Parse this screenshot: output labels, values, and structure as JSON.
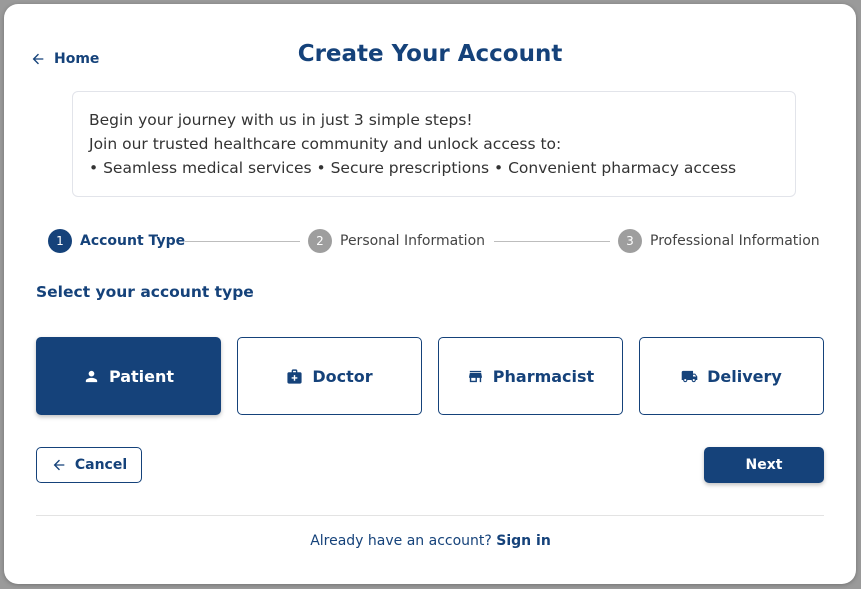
{
  "nav": {
    "home_label": "Home"
  },
  "header": {
    "title": "Create Your Account"
  },
  "intro": {
    "line1": "Begin your journey with us in just 3 simple steps!",
    "line2": "Join our trusted healthcare community and unlock access to:",
    "line3": "• Seamless medical services • Secure prescriptions • Convenient pharmacy access"
  },
  "stepper": {
    "steps": [
      {
        "number": "1",
        "label": "Account Type",
        "state": "active"
      },
      {
        "number": "2",
        "label": "Personal Information",
        "state": "inactive"
      },
      {
        "number": "3",
        "label": "Professional Information",
        "state": "inactive"
      }
    ]
  },
  "account_types": {
    "heading": "Select your account type",
    "selected": "Patient",
    "options": [
      {
        "label": "Patient",
        "icon": "person-icon"
      },
      {
        "label": "Doctor",
        "icon": "medical-bag-icon"
      },
      {
        "label": "Pharmacist",
        "icon": "store-icon"
      },
      {
        "label": "Delivery",
        "icon": "truck-icon"
      }
    ]
  },
  "actions": {
    "cancel_label": "Cancel",
    "next_label": "Next"
  },
  "footer": {
    "prompt": "Already have an account?",
    "signin_label": "Sign in"
  },
  "colors": {
    "primary": "#15427a",
    "step_inactive": "#9e9e9e",
    "border": "#e2e4ea"
  }
}
